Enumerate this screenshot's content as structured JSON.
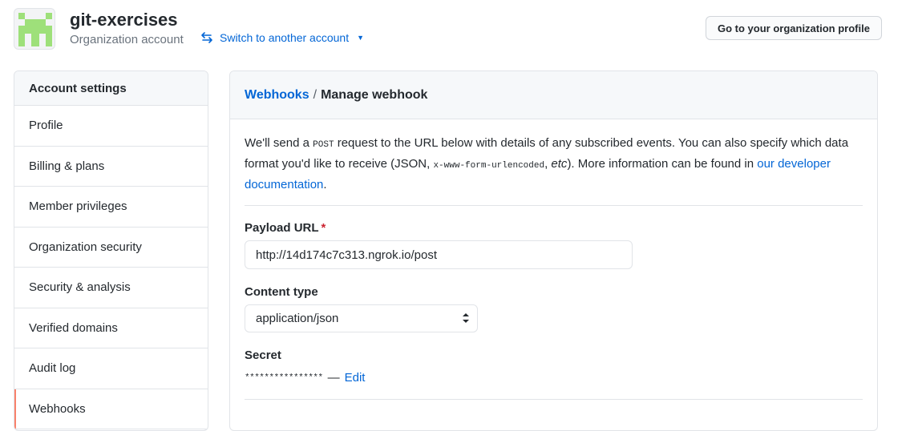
{
  "org": {
    "name": "git-exercises",
    "type": "Organization account",
    "switch_label": "Switch to another account",
    "profile_button": "Go to your organization profile"
  },
  "sidebar": {
    "heading": "Account settings",
    "items": [
      {
        "label": "Profile"
      },
      {
        "label": "Billing & plans"
      },
      {
        "label": "Member privileges"
      },
      {
        "label": "Organization security"
      },
      {
        "label": "Security & analysis"
      },
      {
        "label": "Verified domains"
      },
      {
        "label": "Audit log"
      },
      {
        "label": "Webhooks",
        "selected": true
      }
    ],
    "accent_color": "#f9826c"
  },
  "panel": {
    "breadcrumb_link": "Webhooks",
    "breadcrumb_sep": "/",
    "breadcrumb_current": "Manage webhook",
    "intro": {
      "part1": "We'll send a ",
      "code1": "POST",
      "part2": " request to the URL below with details of any subscribed events. You can also specify which data format you'd like to receive (JSON, ",
      "code2": "x-www-form-urlencoded",
      "part3": ", ",
      "italic": "etc",
      "part4": "). More information can be found in ",
      "link": "our developer documentation",
      "part5": "."
    },
    "payload_label": "Payload URL",
    "required_mark": "*",
    "payload_value": "http://14d174c7c313.ngrok.io/post",
    "content_type_label": "Content type",
    "content_type_value": "application/json",
    "secret_label": "Secret",
    "secret_mask": "****************",
    "secret_dash": "—",
    "edit_link": "Edit"
  },
  "colors": {
    "link": "#0366d6",
    "avatar_green": "#9ee07a"
  }
}
